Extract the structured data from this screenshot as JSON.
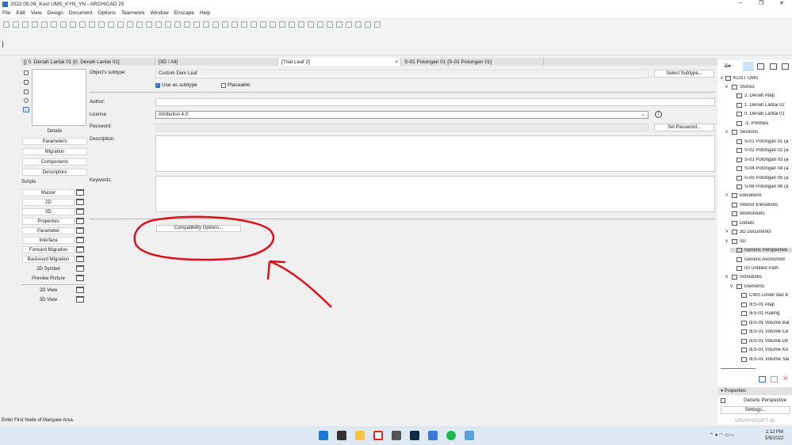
{
  "window": {
    "title": "2022.05.09_Kost UMS_KYN_YN - ARCHICAD 25"
  },
  "menu": [
    "File",
    "Edit",
    "View",
    "Design",
    "Document",
    "Options",
    "Teamwork",
    "Window",
    "Enscape",
    "Help"
  ],
  "tabs": [
    {
      "label": "[] 0. Denah Lantai 01 [0. Denah Lantai 01]"
    },
    {
      "label": "[3D / All]"
    },
    {
      "label": "[Trial Leaf 2]",
      "close": "×"
    },
    {
      "label": "S-01 Potongan 01 [S-01 Potongan 01]"
    }
  ],
  "left": {
    "buttons": [
      "Details",
      "Parameters",
      "Migration",
      "Components",
      "Descriptors"
    ],
    "scripts_label": "Scripts",
    "scripts": [
      "Master",
      "2D",
      "3D",
      "Properties",
      "Parameter",
      "Interface",
      "Forward Migration",
      "Backward Migration",
      "2D Symbol",
      "Preview Picture"
    ],
    "views": [
      "2D View",
      "3D View"
    ]
  },
  "form": {
    "subtype_label": "Object's subtype:",
    "subtype_value": "Custom Door Leaf",
    "select_subtype": "Select Subtype...",
    "use_as_subtype": "Use as subtype",
    "placeable": "Placeable",
    "author_label": "Author:",
    "author_value": "",
    "license_label": "License:",
    "license_value": "Attribution 4.0",
    "password_label": "Password:",
    "set_password": "Set Password...",
    "description_label": "Description:",
    "keywords_label": "Keywords:",
    "compat": "Compatibility Options..."
  },
  "navigator": {
    "root": "KOST UMS",
    "items": [
      {
        "label": "Stories",
        "lvl": 1,
        "exp": "v"
      },
      {
        "label": "2. Denah Atap",
        "lvl": 2
      },
      {
        "label": "1. Denah Lantai 02",
        "lvl": 2
      },
      {
        "label": "0. Denah Lantai 01",
        "lvl": 2
      },
      {
        "label": "-1. Pondasi",
        "lvl": 2
      },
      {
        "label": "Sections",
        "lvl": 1,
        "exp": "v"
      },
      {
        "label": "S-01 Potongan 01 (a",
        "lvl": 2
      },
      {
        "label": "S-02 Potongan 02 (a",
        "lvl": 2
      },
      {
        "label": "S-03 Potongan 03 (a",
        "lvl": 2
      },
      {
        "label": "S-04 Potongan 04 (a",
        "lvl": 2
      },
      {
        "label": "S-05 Potongan 05 (a",
        "lvl": 2
      },
      {
        "label": "S-06 Potongan 06 (a",
        "lvl": 2
      },
      {
        "label": "Elevations",
        "lvl": 1,
        "exp": ">"
      },
      {
        "label": "Interior Elevations",
        "lvl": 1
      },
      {
        "label": "Worksheets",
        "lvl": 1
      },
      {
        "label": "Details",
        "lvl": 1
      },
      {
        "label": "3D Documents",
        "lvl": 1,
        "exp": ">"
      },
      {
        "label": "3D",
        "lvl": 1,
        "exp": "v"
      },
      {
        "label": "Generic Perspective",
        "lvl": 2,
        "sel": true
      },
      {
        "label": "Generic Axonometr",
        "lvl": 2
      },
      {
        "label": "00 Untitled Path",
        "lvl": 2
      },
      {
        "label": "Schedules",
        "lvl": 1,
        "exp": "v"
      },
      {
        "label": "Elements",
        "lvl": 2,
        "exp": "v"
      },
      {
        "label": "CWS Loster dan b",
        "lvl": 3
      },
      {
        "label": "IES-01 Atap",
        "lvl": 3
      },
      {
        "label": "IES-01 Railing",
        "lvl": 3
      },
      {
        "label": "IES-01 Volume Bal",
        "lvl": 3
      },
      {
        "label": "IES-01 Volume Ce",
        "lvl": 3
      },
      {
        "label": "IES-01 Volume Dir",
        "lvl": 3
      },
      {
        "label": "IES-01 Volume Ko",
        "lvl": 3
      },
      {
        "label": "IES-01 Volume Sla",
        "lvl": 3
      }
    ],
    "properties_label": "Properties",
    "properties_value": "Generic Perspective",
    "settings": "Settings...",
    "graphisoft": "GRAPHISOFT ID"
  },
  "status": "Enter First Node of Marquee Area.",
  "taskbar": {
    "time": "1:12 PM",
    "date": "5/9/2022"
  }
}
